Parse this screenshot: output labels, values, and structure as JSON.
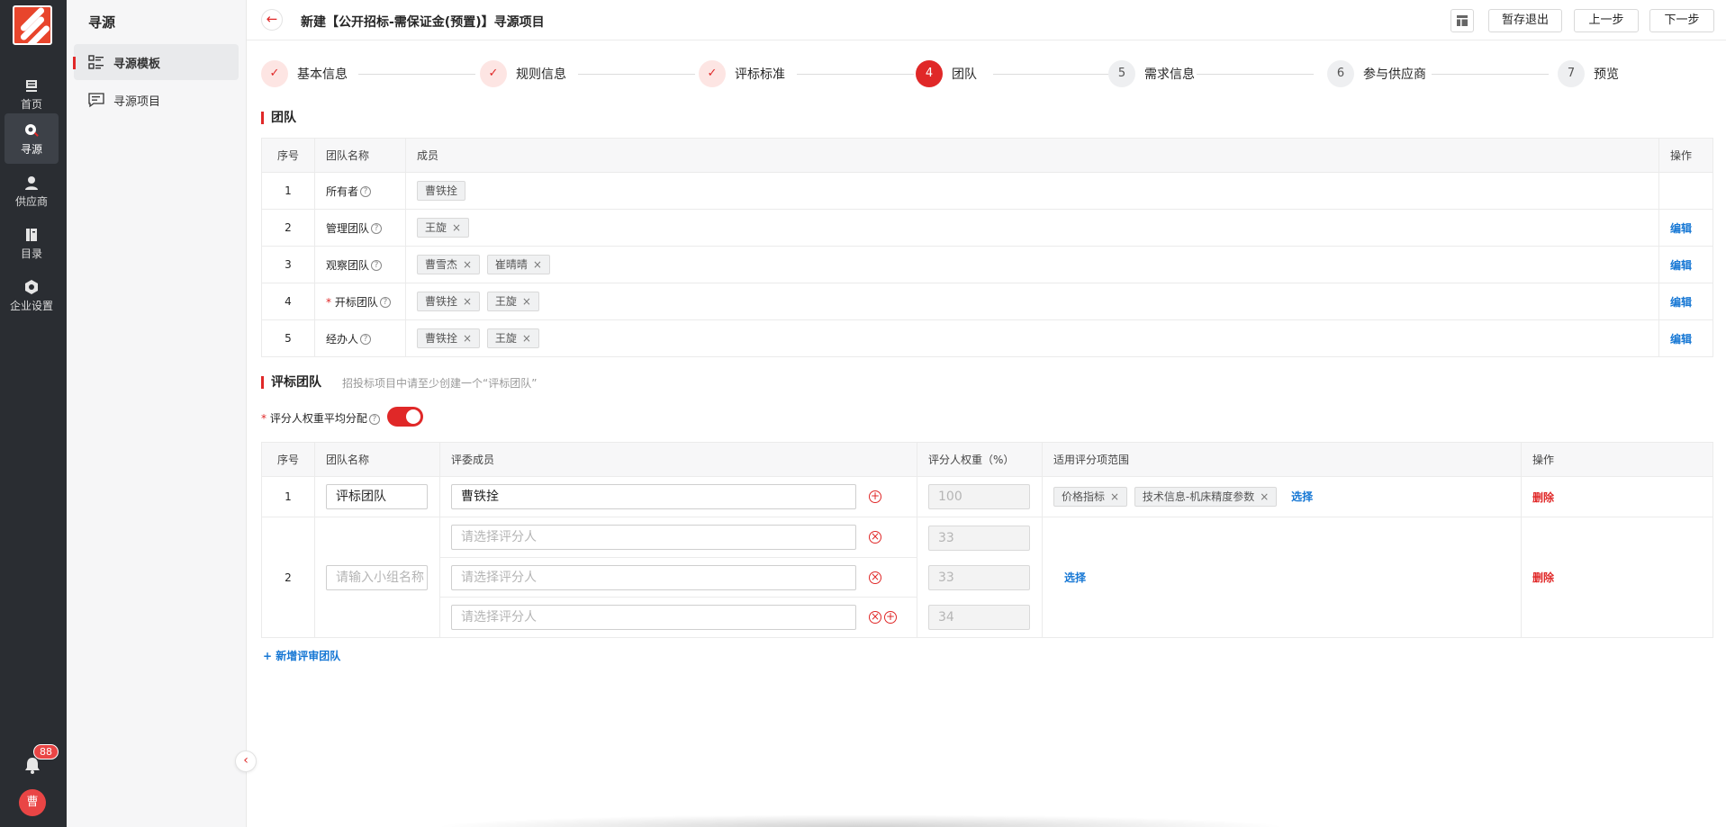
{
  "rail": {
    "items": [
      {
        "label": "首页"
      },
      {
        "label": "寻源"
      },
      {
        "label": "供应商"
      },
      {
        "label": "目录"
      },
      {
        "label": "企业设置"
      }
    ],
    "notification_count": "88",
    "avatar_text": "曹"
  },
  "sidebar": {
    "title": "寻源",
    "items": [
      {
        "label": "寻源模板"
      },
      {
        "label": "寻源项目"
      }
    ]
  },
  "header": {
    "title": "新建【公开招标-需保证金(预置)】寻源项目",
    "save_exit": "暂存退出",
    "prev": "上一步",
    "next": "下一步"
  },
  "steps": [
    {
      "num": "✓",
      "label": "基本信息",
      "state": "done"
    },
    {
      "num": "✓",
      "label": "规则信息",
      "state": "done"
    },
    {
      "num": "✓",
      "label": "评标标准",
      "state": "done"
    },
    {
      "num": "4",
      "label": "团队",
      "state": "current"
    },
    {
      "num": "5",
      "label": "需求信息",
      "state": "todo"
    },
    {
      "num": "6",
      "label": "参与供应商",
      "state": "todo"
    },
    {
      "num": "7",
      "label": "预览",
      "state": "todo"
    }
  ],
  "team": {
    "title": "团队",
    "columns": [
      "序号",
      "团队名称",
      "成员",
      "操作"
    ],
    "rows": [
      {
        "no": "1",
        "name": "所有者",
        "members": [
          "曹铁拴"
        ]
      },
      {
        "no": "2",
        "name": "管理团队",
        "members": [
          "王旋"
        ],
        "action": "编辑"
      },
      {
        "no": "3",
        "name": "观察团队",
        "members": [
          "曹雪杰",
          "崔晴晴"
        ],
        "action": "编辑"
      },
      {
        "no": "4",
        "name": "开标团队",
        "required": "*",
        "members": [
          "曹铁拴",
          "王旋"
        ],
        "action": "编辑"
      },
      {
        "no": "5",
        "name": "经办人",
        "members": [
          "曹铁拴",
          "王旋"
        ],
        "action": "编辑"
      }
    ]
  },
  "eval": {
    "title": "评标团队",
    "hint": "招投标项目中请至少创建一个“评标团队”",
    "weight_label": "评分人权重平均分配",
    "required": "*",
    "columns": [
      "序号",
      "团队名称",
      "评委成员",
      "评分人权重（%）",
      "适用评分项范围",
      "操作"
    ],
    "rows": [
      {
        "no": "1",
        "name": "评标团队",
        "members": [
          {
            "value": "曹铁拴",
            "weight": "100"
          }
        ],
        "scope_tags": [
          "价格指标",
          "技术信息-机床精度参数"
        ],
        "select": "选择",
        "delete": "删除"
      },
      {
        "no": "2",
        "name_placeholder": "请输入小组名称",
        "members": [
          {
            "placeholder": "请选择评分人",
            "weight": "33"
          },
          {
            "placeholder": "请选择评分人",
            "weight": "33"
          },
          {
            "placeholder": "请选择评分人",
            "weight": "34"
          }
        ],
        "select": "选择",
        "delete": "删除"
      }
    ],
    "add_team": "+ 新增评审团队"
  },
  "colors": {
    "accent": "#e02828",
    "link": "#1677d4"
  }
}
